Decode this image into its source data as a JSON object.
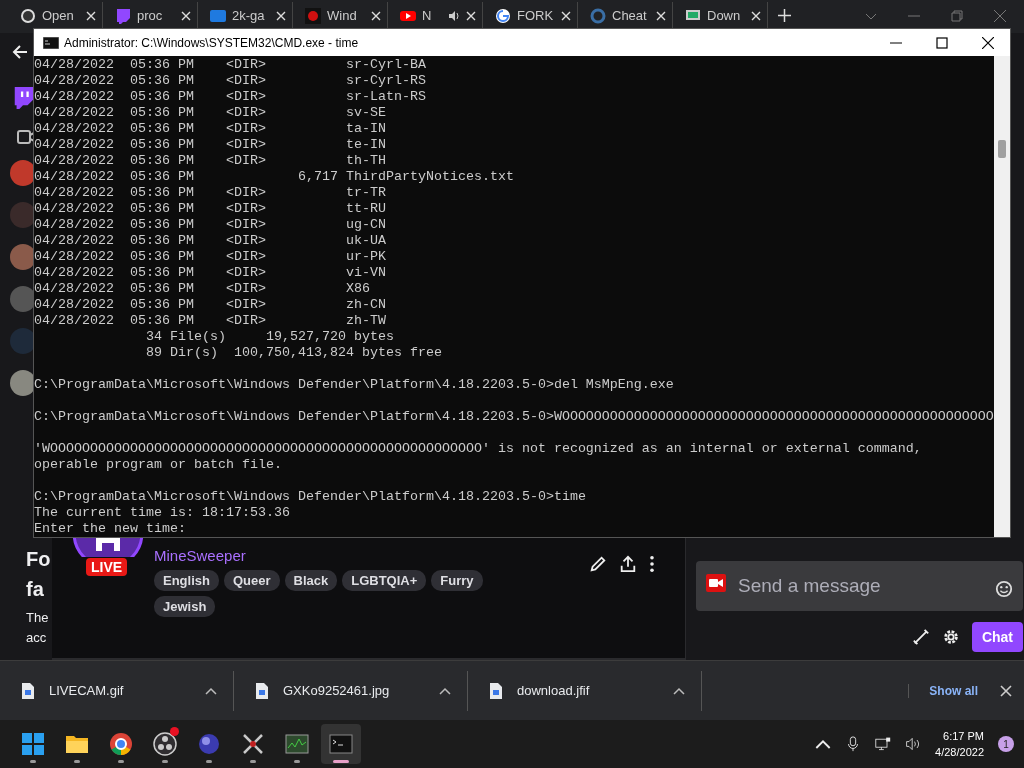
{
  "browser": {
    "tabs": [
      {
        "title": "Open",
        "kind": "obs",
        "audio": false
      },
      {
        "title": "proc",
        "kind": "twitch",
        "audio": false
      },
      {
        "title": "2k-ga",
        "kind": "gif",
        "audio": false
      },
      {
        "title": "Wind",
        "kind": "redball",
        "audio": false
      },
      {
        "title": "N",
        "kind": "youtube",
        "audio": true
      },
      {
        "title": "FORK",
        "kind": "google",
        "audio": false
      },
      {
        "title": "Cheat",
        "kind": "cheat",
        "audio": false
      },
      {
        "title": "Down",
        "kind": "monitor",
        "audio": false
      }
    ]
  },
  "twitch": {
    "heading": [
      "Fo",
      "fa"
    ],
    "body_text": [
      "The",
      "acc"
    ],
    "stream": {
      "live_badge": "LIVE",
      "category": "MineSweeper",
      "tags": [
        "English",
        "Queer",
        "Black",
        "LGBTQIA+",
        "Furry",
        "Jewish"
      ]
    },
    "chat": {
      "placeholder": "Send a message",
      "button": "Chat"
    }
  },
  "cmd_window": {
    "title": "Administrator: C:\\Windows\\SYSTEM32\\CMD.exe - time",
    "blocks": [
      [
        "04/28/2022  05:36 PM    <DIR>          sr-Cyrl-BA",
        "04/28/2022  05:36 PM    <DIR>          sr-Cyrl-RS",
        "04/28/2022  05:36 PM    <DIR>          sr-Latn-RS",
        "04/28/2022  05:36 PM    <DIR>          sv-SE",
        "04/28/2022  05:36 PM    <DIR>          ta-IN",
        "04/28/2022  05:36 PM    <DIR>          te-IN",
        "04/28/2022  05:36 PM    <DIR>          th-TH",
        "04/28/2022  05:36 PM             6,717 ThirdPartyNotices.txt",
        "04/28/2022  05:36 PM    <DIR>          tr-TR",
        "04/28/2022  05:36 PM    <DIR>          tt-RU",
        "04/28/2022  05:36 PM    <DIR>          ug-CN",
        "04/28/2022  05:36 PM    <DIR>          uk-UA",
        "04/28/2022  05:36 PM    <DIR>          ur-PK",
        "04/28/2022  05:36 PM    <DIR>          vi-VN",
        "04/28/2022  05:36 PM    <DIR>          X86",
        "04/28/2022  05:36 PM    <DIR>          zh-CN",
        "04/28/2022  05:36 PM    <DIR>          zh-TW",
        "              34 File(s)     19,527,720 bytes",
        "              89 Dir(s)  100,750,413,824 bytes free"
      ],
      [
        "C:\\ProgramData\\Microsoft\\Windows Defender\\Platform\\4.18.2203.5-0>del MsMpEng.exe"
      ],
      [
        "C:\\ProgramData\\Microsoft\\Windows Defender\\Platform\\4.18.2203.5-0>WOOOOOOOOOOOOOOOOOOOOOOOOOOOOOOOOOOOOOOOOOOOOOOOOOOOOOO"
      ],
      [
        "'WOOOOOOOOOOOOOOOOOOOOOOOOOOOOOOOOOOOOOOOOOOOOOOOOOOOOOO' is not recognized as an internal or external command,",
        "operable program or batch file."
      ],
      [
        "C:\\ProgramData\\Microsoft\\Windows Defender\\Platform\\4.18.2203.5-0>time",
        "The current time is: 18:17:53.36",
        "Enter the new time:"
      ]
    ]
  },
  "downloads": {
    "items": [
      "LIVECAM.gif",
      "GXKo9252461.jpg",
      "download.jfif"
    ],
    "show_all": "Show all"
  },
  "taskbar": {
    "apps": [
      {
        "kind": "start",
        "selected": false,
        "alert": false
      },
      {
        "kind": "explorer",
        "selected": false,
        "alert": false
      },
      {
        "kind": "chrome",
        "selected": false,
        "alert": false
      },
      {
        "kind": "obs",
        "selected": false,
        "alert": true
      },
      {
        "kind": "ball",
        "selected": false,
        "alert": false
      },
      {
        "kind": "swords",
        "selected": false,
        "alert": false
      },
      {
        "kind": "monitor",
        "selected": false,
        "alert": false
      },
      {
        "kind": "terminal",
        "selected": true,
        "alert": false
      }
    ],
    "time": "6:17 PM",
    "date": "4/28/2022",
    "notifications": "1"
  }
}
